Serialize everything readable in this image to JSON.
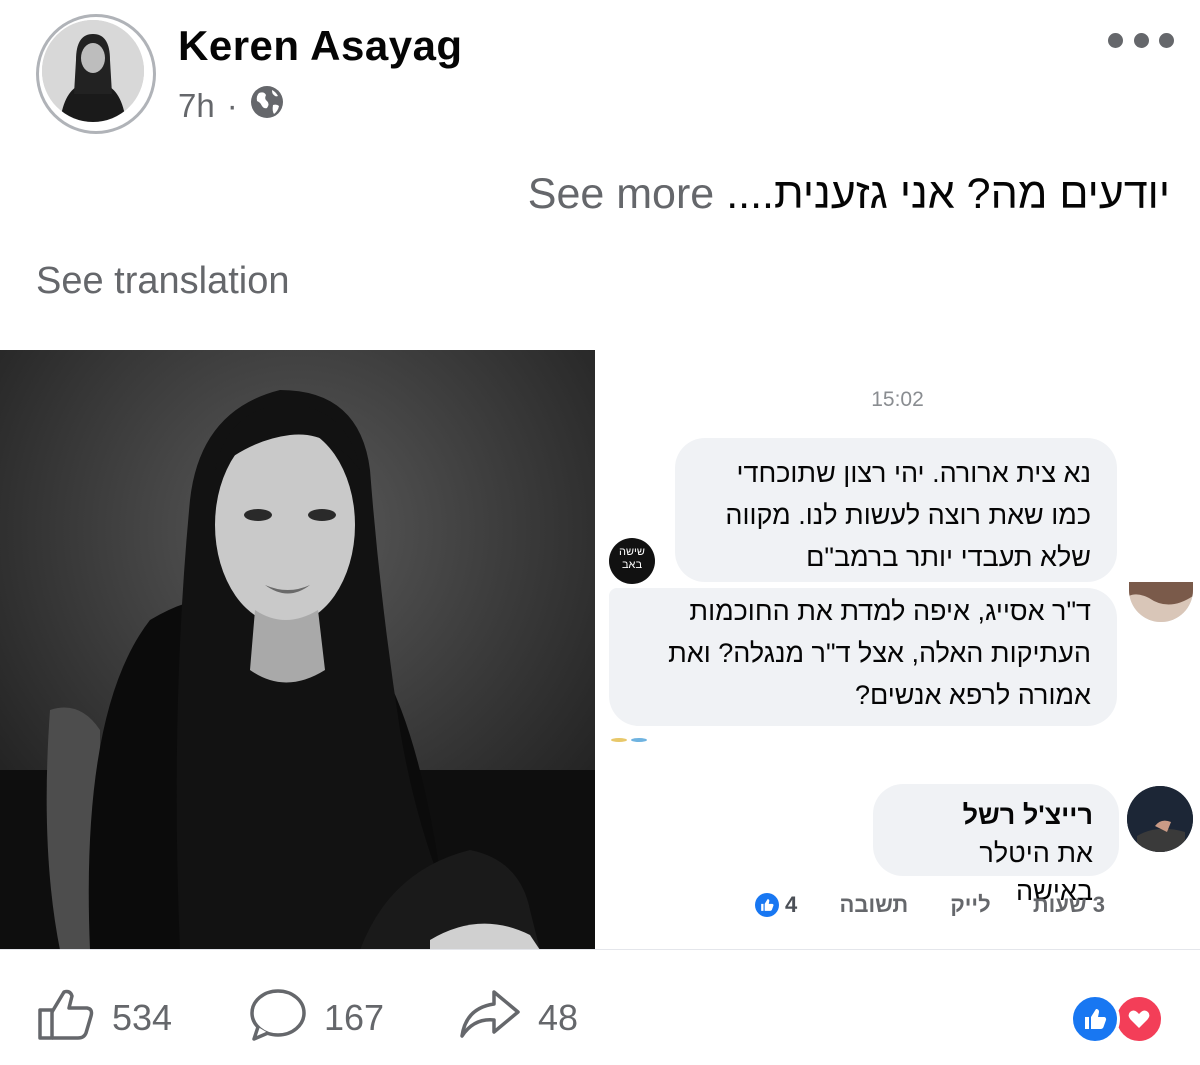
{
  "post": {
    "author": "Keren Asayag",
    "time": "7h",
    "audience_icon": "globe-icon",
    "text": "יודעים מה? אני גזענית....",
    "see_more": "See more",
    "see_translation": "See translation"
  },
  "screenshot": {
    "time": "15:02",
    "message1": "נא צית ארורה. יהי רצון שתוכחדי כמו שאת רוצה לעשות לנו. מקווה שלא תעבדי יותר ברמב\"ם",
    "badge_text": "שישה באב",
    "message2": "ד\"ר אסייג, איפה למדת את החוכמות העתיקות האלה, אצל ד\"ר מנגלה? ואת אמורה לרפא אנשים?",
    "commenter_name": "רייצ'ל רשל",
    "comment_text": "את היטלר באישה",
    "comment_time": "3 שעות",
    "comment_like": "לייק",
    "comment_reply": "תשובה",
    "comment_reactions": "4"
  },
  "footer": {
    "likes": "534",
    "comments": "167",
    "shares": "48"
  },
  "colors": {
    "text": "#050505",
    "secondary": "#65676b",
    "bubble": "#f0f2f5",
    "like_blue": "#1877f2",
    "love_red": "#f33e58"
  }
}
